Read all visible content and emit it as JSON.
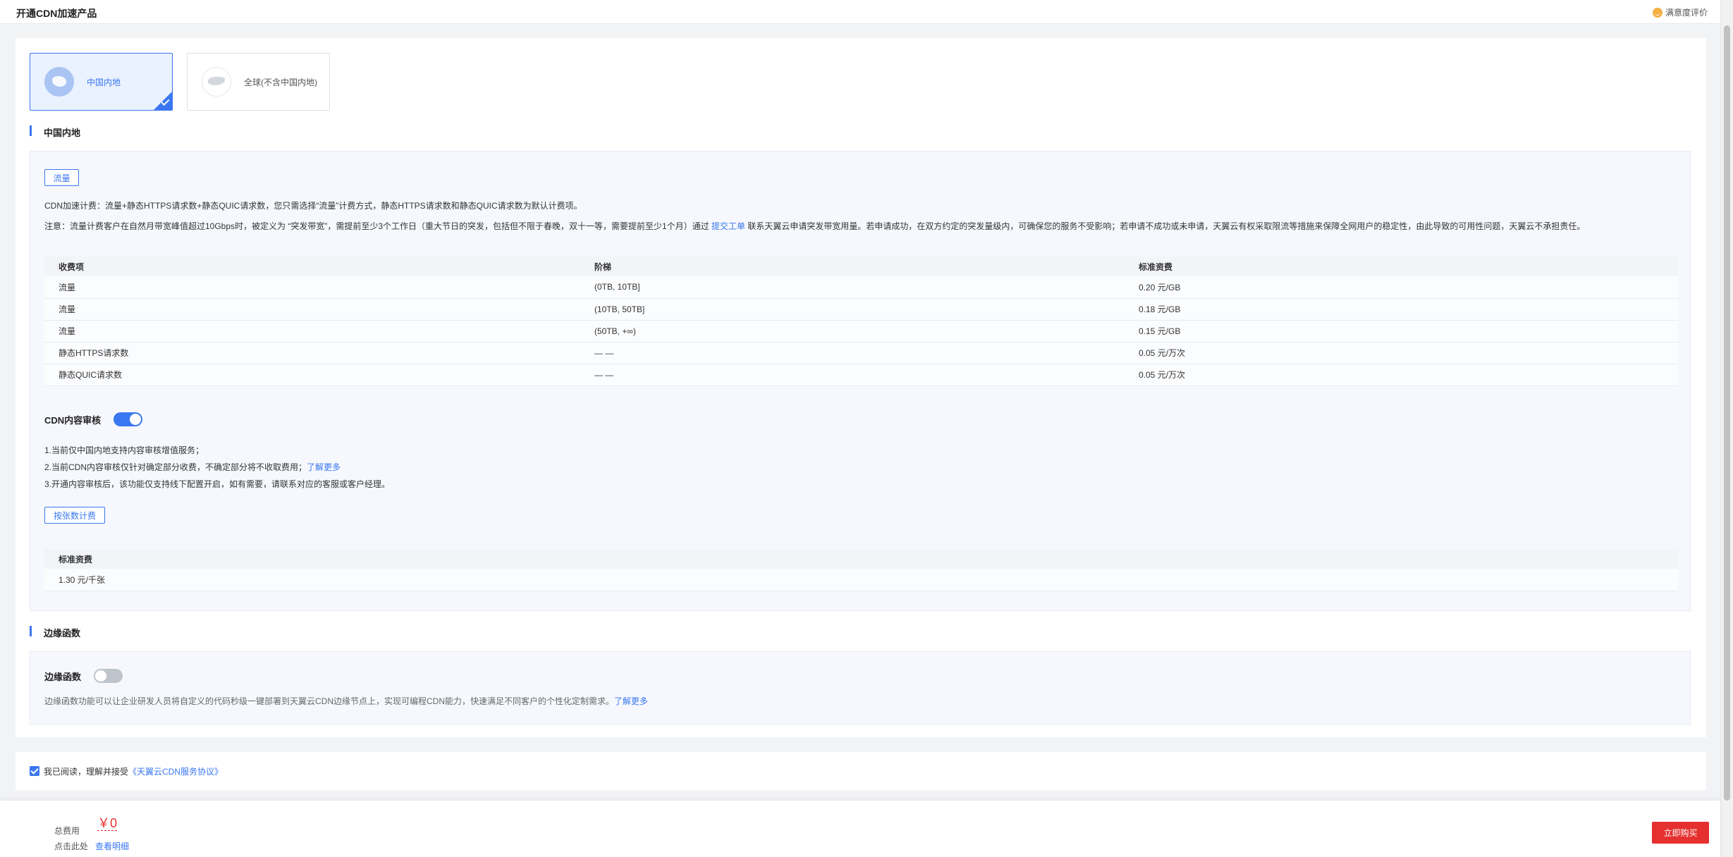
{
  "header": {
    "title": "开通CDN加速产品",
    "rating_label": "满意度评价",
    "rating_icon": "smile-icon"
  },
  "region_tabs": [
    {
      "label": "中国内地",
      "selected": true,
      "icon": "china-map-icon"
    },
    {
      "label": "全球(不含中国内地)",
      "selected": false,
      "icon": "world-map-icon"
    }
  ],
  "mainland": {
    "section_title": "中国内地",
    "billing_tag": "流量",
    "billing_desc": "CDN加速计费：流量+静态HTTPS请求数+静态QUIC请求数，您只需选择“流量”计费方式，静态HTTPS请求数和静态QUIC请求数为默认计费项。",
    "notice_before": "注意：流量计费客户在自然月带宽峰值超过10Gbps时，被定义为 “突发带宽”，需提前至少3个工作日（重大节日的突发，包括但不限于春晚，双十一等，需要提前至少1个月）通过 ",
    "notice_link": "提交工单",
    "notice_after": " 联系天翼云申请突发带宽用量。若申请成功，在双方约定的突发量级内，可确保您的服务不受影响；若申请不成功或未申请，天翼云有权采取限流等措施来保障全网用户的稳定性，由此导致的可用性问题，天翼云不承担责任。",
    "table": {
      "headers": [
        "收费项",
        "阶梯",
        "标准资费"
      ],
      "rows": [
        [
          "流量",
          "(0TB, 10TB]",
          "0.20 元/GB"
        ],
        [
          "流量",
          "(10TB, 50TB]",
          "0.18 元/GB"
        ],
        [
          "流量",
          "(50TB, +∞)",
          "0.15 元/GB"
        ],
        [
          "静态HTTPS请求数",
          "— —",
          "0.05 元/万次"
        ],
        [
          "静态QUIC请求数",
          "— —",
          "0.05 元/万次"
        ]
      ]
    }
  },
  "audit": {
    "label": "CDN内容审核",
    "enabled": true,
    "note1": "1.当前仅中国内地支持内容审核增值服务；",
    "note2_text": "2.当前CDN内容审核仅针对确定部分收费，不确定部分将不收取费用；",
    "note2_link": "了解更多",
    "note3": "3.开通内容审核后，该功能仅支持线下配置开启，如有需要，请联系对应的客服或客户经理。",
    "tag": "按张数计费",
    "table_header": "标准资费",
    "table_value": "1.30 元/千张"
  },
  "edge": {
    "section_title": "边缘函数",
    "toggle_label": "边缘函数",
    "enabled": false,
    "desc": "边缘函数功能可以让企业研发人员将自定义的代码秒级一键部署到天翼云CDN边缘节点上，实现可编程CDN能力，快速满足不同客户的个性化定制需求。",
    "link": "了解更多"
  },
  "agreement": {
    "checked": true,
    "text": "我已阅读，理解并接受",
    "link": "《天翼云CDN服务协议》"
  },
  "footer": {
    "total_label": "总费用",
    "price": "￥0",
    "detail_prefix": "点击此处",
    "detail_link": "查看明细",
    "buy_label": "立即购买"
  },
  "colors": {
    "accent": "#3a77f0",
    "danger": "#e5302f"
  }
}
